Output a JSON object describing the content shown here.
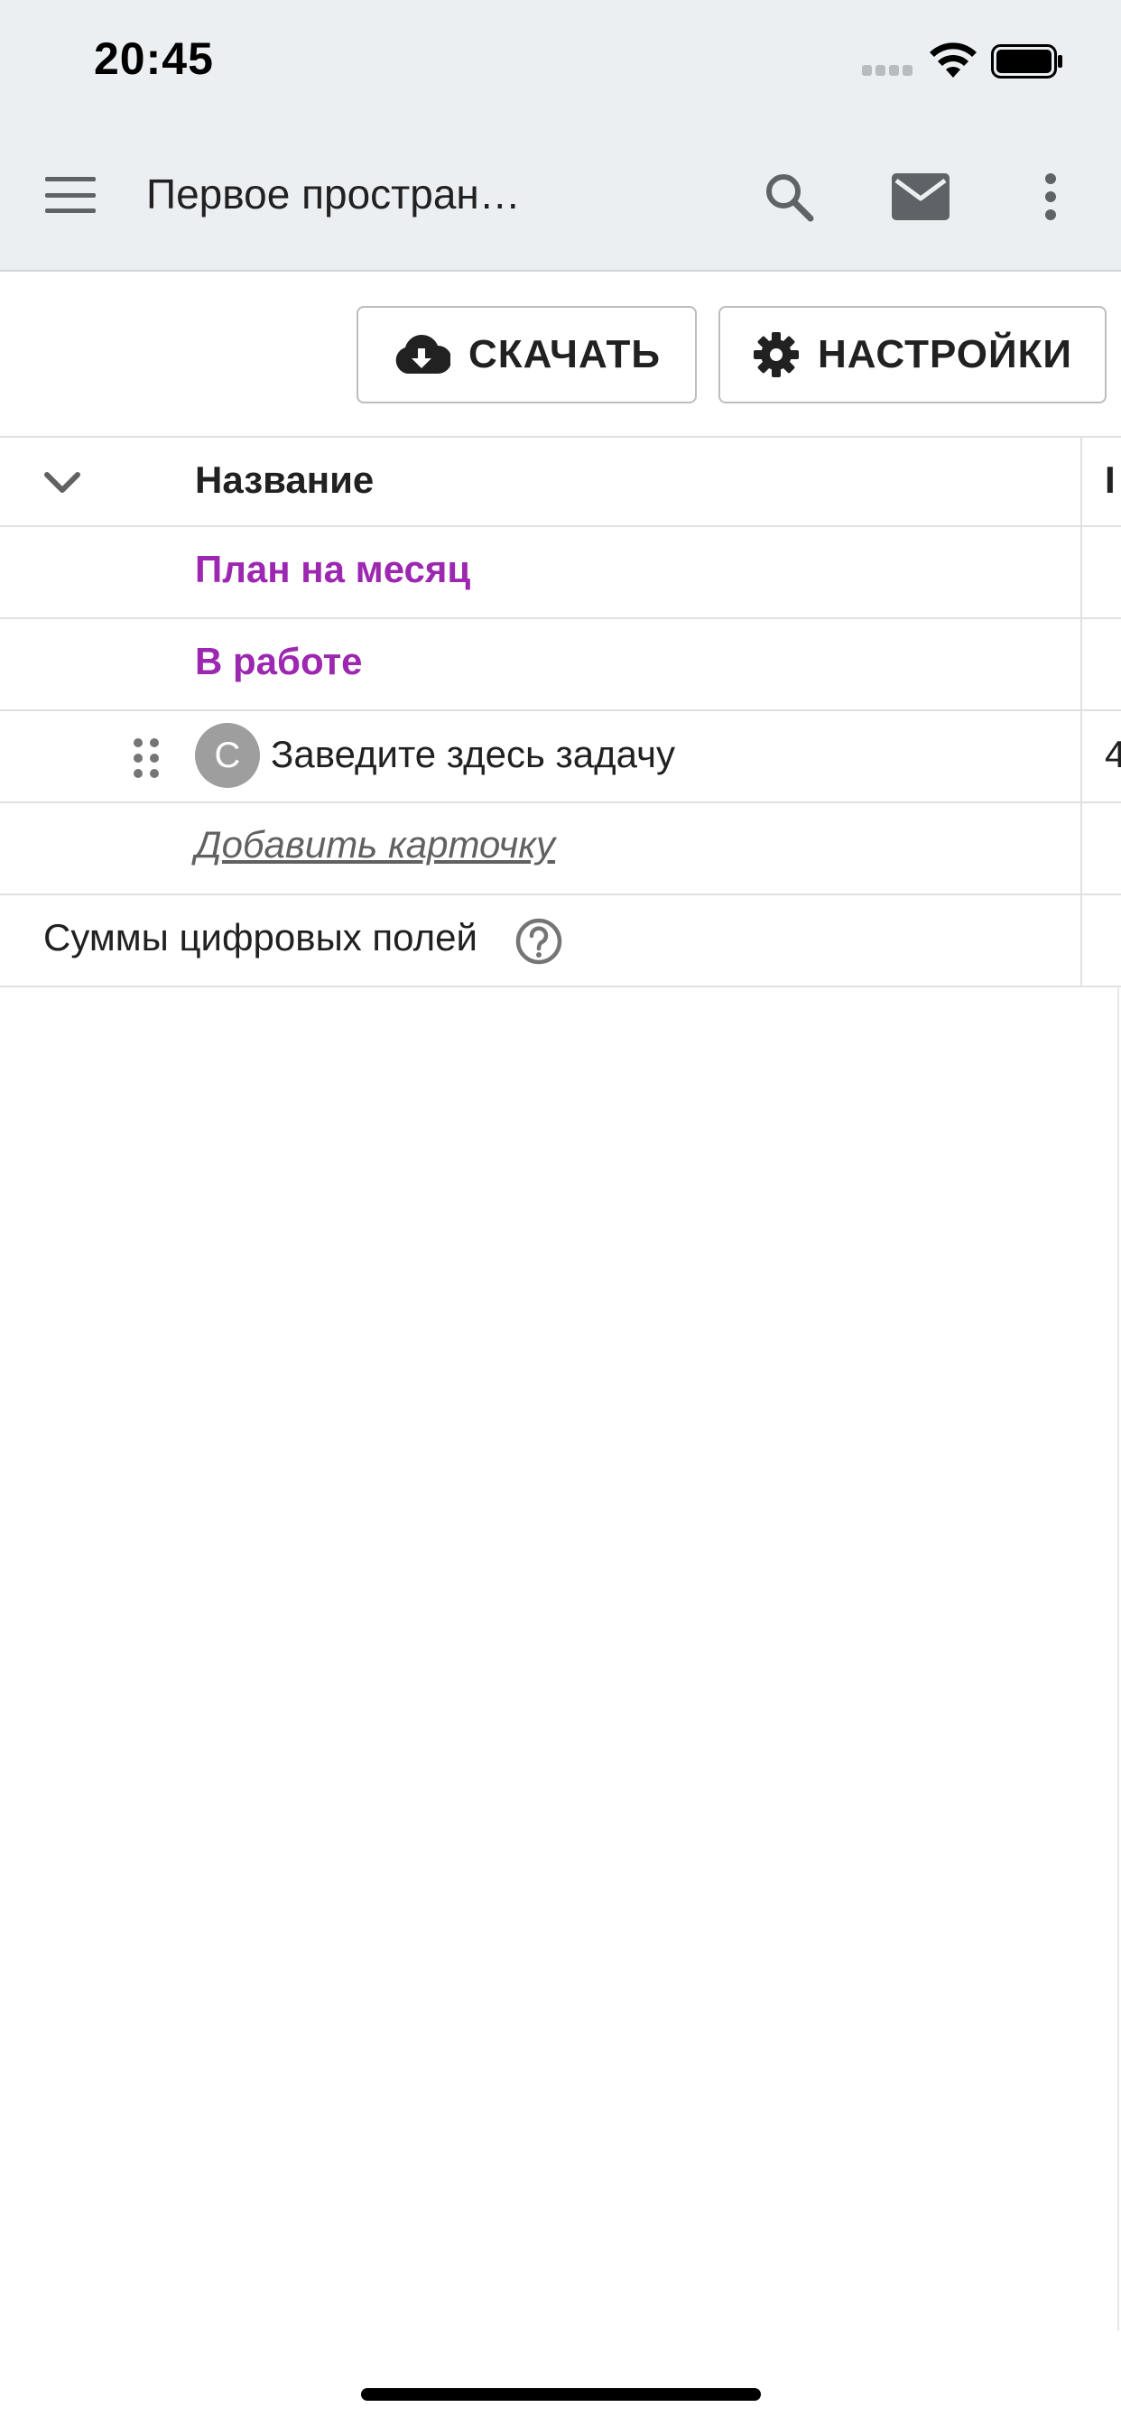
{
  "status_bar": {
    "time": "20:45"
  },
  "app_bar": {
    "title": "Первое простран…"
  },
  "toolbar": {
    "download_label": "СКАЧАТЬ",
    "settings_label": "НАСТРОЙКИ"
  },
  "table": {
    "column_header": "Название",
    "next_column_header_partial": "I",
    "groups": [
      {
        "label": "План на месяц"
      },
      {
        "label": "В работе"
      }
    ],
    "task": {
      "avatar_letter": "С",
      "title": "Заведите здесь задачу",
      "next_cell_partial": "4"
    },
    "add_card_label": "Добавить карточку",
    "sums_label": "Суммы цифровых полей"
  },
  "colors": {
    "appbar_bg": "#eceff1",
    "group_accent": "#9c27b0",
    "icon_gray": "#5f6368"
  },
  "icons": [
    "menu-icon",
    "search-icon",
    "mail-icon",
    "more-vert-icon",
    "cloud-download-icon",
    "gear-icon",
    "chevron-down-icon",
    "drag-handle-icon",
    "help-circle-icon"
  ]
}
